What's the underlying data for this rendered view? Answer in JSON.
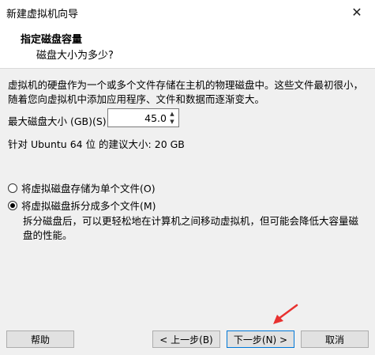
{
  "window": {
    "title": "新建虚拟机向导",
    "close_glyph": "✕"
  },
  "header": {
    "title": "指定磁盘容量",
    "subtitle": "磁盘大小为多少?"
  },
  "description": "虚拟机的硬盘作为一个或多个文件存储在主机的物理磁盘中。这些文件最初很小，随着您向虚拟机中添加应用程序、文件和数据而逐渐变大。",
  "disk_size": {
    "label": "最大磁盘大小 (GB)(S):",
    "value": "45.0"
  },
  "recommendation": "针对 Ubuntu 64 位 的建议大小: 20 GB",
  "options": {
    "single_label": "将虚拟磁盘存储为单个文件(O)",
    "multi_label": "将虚拟磁盘拆分成多个文件(M)",
    "multi_desc": "拆分磁盘后，可以更轻松地在计算机之间移动虚拟机，但可能会降低大容量磁盘的性能。",
    "selected": "multi"
  },
  "footer": {
    "help_label": "帮助",
    "back_label": "< 上一步(B)",
    "next_label": "下一步(N) >",
    "cancel_label": "取消"
  },
  "colors": {
    "annotation_arrow": "#e8312f",
    "primary_border": "#0078d7"
  }
}
